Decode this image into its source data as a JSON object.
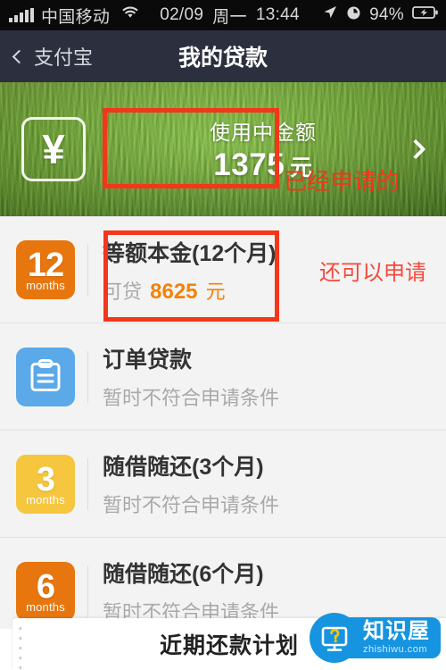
{
  "status_bar": {
    "carrier": "中国移动",
    "date": "02/09",
    "weekday": "周一",
    "time": "13:44",
    "battery_percent": "94%",
    "icons": [
      "signal-bars-icon",
      "wifi-icon",
      "location-arrow-icon",
      "alarm-clock-icon",
      "battery-charging-icon"
    ]
  },
  "nav": {
    "back_label": "支付宝",
    "title": "我的贷款"
  },
  "hero": {
    "icon": "yen-symbol-icon",
    "yen_glyph": "¥",
    "label": "使用中金额",
    "amount": "1375",
    "unit": "元",
    "arrow": "chevron-right-icon"
  },
  "loans": [
    {
      "badge_num": "12",
      "badge_unit": "months",
      "badge_style": "orange",
      "badge_color": "#e8760e",
      "title": "等额本金(12个月)",
      "sub_prefix": "可贷",
      "sub_amount": "8625",
      "sub_unit": "元",
      "note": "还可以申请",
      "note_color": "#f4493d"
    },
    {
      "badge_num": "",
      "badge_unit": "",
      "badge_style": "clip",
      "badge_color": "#5ba9e8",
      "badge_icon": "clipboard-icon",
      "title": "订单贷款",
      "sub_text": "暂时不符合申请条件",
      "note": ""
    },
    {
      "badge_num": "3",
      "badge_unit": "months",
      "badge_style": "yellow",
      "badge_color": "#f5c63e",
      "title": "随借随还(3个月)",
      "sub_text": "暂时不符合申请条件",
      "note": ""
    },
    {
      "badge_num": "6",
      "badge_unit": "months",
      "badge_style": "orange",
      "badge_color": "#e8760e",
      "title": "随借随还(6个月)",
      "sub_text": "暂时不符合申请条件",
      "note": ""
    }
  ],
  "bottom_sheet": {
    "title": "近期还款计划"
  },
  "watermark": {
    "icon": "monitor-question-icon",
    "name": "知识屋",
    "url": "zhishiwu.com",
    "color": "#1694e0"
  },
  "annotations": {
    "box_color": "#f4361a",
    "hero_note": "已经申请的",
    "hero_note_color": "#f4361a"
  }
}
